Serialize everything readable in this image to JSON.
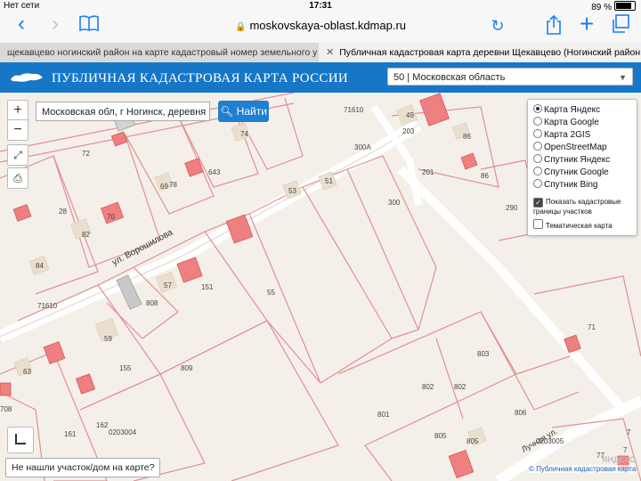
{
  "status": {
    "carrier": "Нет сети",
    "time": "17:31",
    "battery": "89 %"
  },
  "address_bar": {
    "url": "moskovskaya-oblast.kdmap.ru"
  },
  "tabs": [
    {
      "label": "щекавцево ногинский район на карте кадастровый номер земельного участ..."
    },
    {
      "label": "Публичная кадастровая карта деревни Щекавцево (Ногинский район, Мос..."
    }
  ],
  "header": {
    "title": "ПУБЛИЧНАЯ КАДАСТРОВАЯ КАРТА РОССИИ",
    "region": "50 | Московская область"
  },
  "search": {
    "value": "Московская обл, г Ногинск, деревня Щє",
    "button": "Найти"
  },
  "controls": {
    "zoom_in": "+",
    "zoom_out": "−"
  },
  "layers": {
    "base": [
      "Карта Яндекс",
      "Карта Google",
      "Карта 2GIS",
      "OpenStreetMap",
      "Спутник Яндекс",
      "Спутник Google",
      "Спутник Bing"
    ],
    "selected": "Карта Яндекс",
    "show_boundaries": "Показать кадастровые границы участков",
    "thematic": "Тематическая карта"
  },
  "map": {
    "street_1": "ул. Ворошилова",
    "street_2": "Лучная ул.",
    "parcel_labels": [
      "72",
      "70",
      "28",
      "82",
      "84",
      "69",
      "78",
      "643",
      "74",
      "53",
      "51",
      "300",
      "300A",
      "49",
      "203",
      "86",
      "86",
      "201",
      "290",
      "57",
      "151",
      "55",
      "808",
      "59",
      "63",
      "155",
      "809",
      "162",
      "161",
      "0203004",
      "803",
      "802",
      "802",
      "801",
      "806",
      "805",
      "805",
      "0203005",
      "71",
      "7",
      "77",
      "7",
      "708",
      "71610",
      "71610"
    ]
  },
  "footer": {
    "not_found": "Не нашли участок/дом на карте?",
    "attribution": "© Публичная кадастровая карта",
    "watermark": "ЯНДЕКС"
  }
}
